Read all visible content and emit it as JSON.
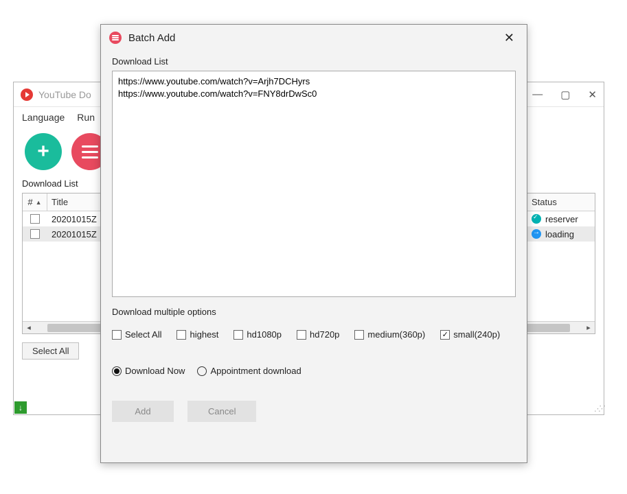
{
  "mainWindow": {
    "title": "YouTube Do",
    "menu": {
      "language": "Language",
      "run": "Run"
    },
    "listLabel": "Download List",
    "columns": {
      "index": "#",
      "title": "Title",
      "status": "Status"
    },
    "rows": [
      {
        "title": "20201015Z",
        "status": "reserver",
        "statusKind": "reserved"
      },
      {
        "title": "20201015Z",
        "status": "loading",
        "statusKind": "loading"
      }
    ],
    "selectAll": "Select All"
  },
  "dialog": {
    "title": "Batch Add",
    "listLabel": "Download List",
    "textarea": "https://www.youtube.com/watch?v=Arjh7DCHyrs\nhttps://www.youtube.com/watch?v=FNY8drDwSc0",
    "multiLabel": "Download multiple options",
    "options": {
      "selectAll": {
        "label": "Select All",
        "checked": false
      },
      "highest": {
        "label": "highest",
        "checked": false
      },
      "hd1080p": {
        "label": "hd1080p",
        "checked": false
      },
      "hd720p": {
        "label": "hd720p",
        "checked": false
      },
      "medium360p": {
        "label": "medium(360p)",
        "checked": false
      },
      "small240p": {
        "label": "small(240p)",
        "checked": true
      }
    },
    "modes": {
      "now": {
        "label": "Download Now",
        "selected": true
      },
      "appt": {
        "label": "Appointment download",
        "selected": false
      }
    },
    "buttons": {
      "add": "Add",
      "cancel": "Cancel"
    }
  }
}
